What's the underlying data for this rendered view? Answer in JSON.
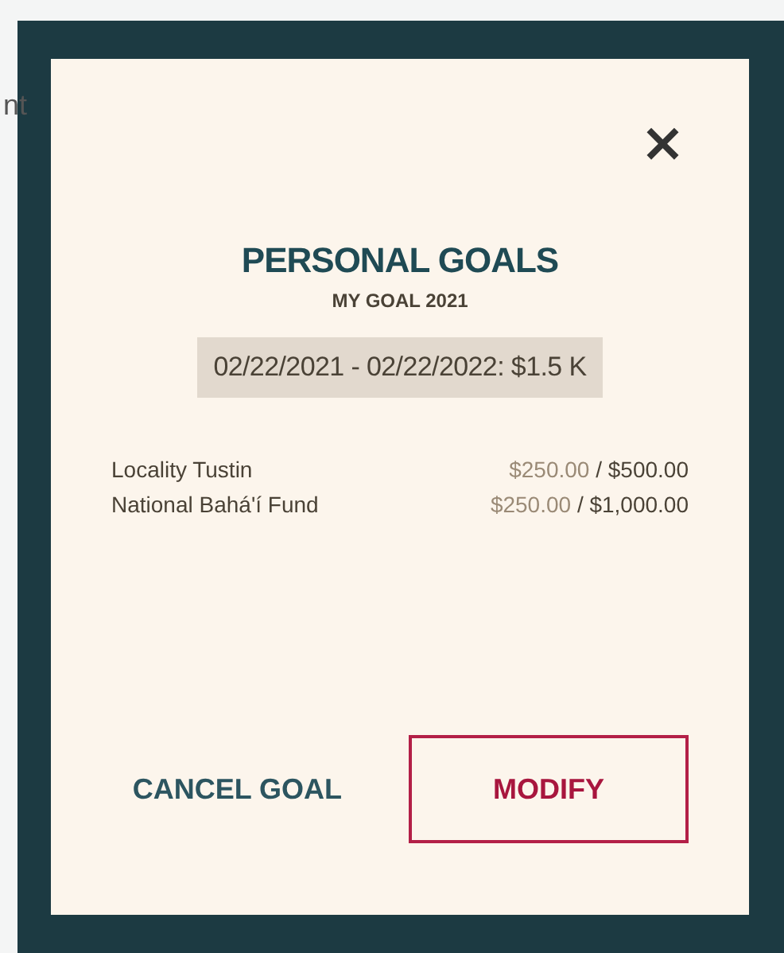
{
  "background_text": "nt",
  "dialog": {
    "close": "×",
    "title": "PERSONAL GOALS",
    "subtitle": "MY GOAL 2021",
    "period": "02/22/2021 - 02/22/2022: $1.5 K",
    "funds": [
      {
        "name": "Locality Tustin",
        "paid": "$250.00",
        "goal": "/ $500.00"
      },
      {
        "name": "National Bahá'í Fund",
        "paid": "$250.00",
        "goal": "/ $1,000.00"
      }
    ],
    "buttons": [
      {
        "label": "CANCEL GOAL",
        "kind": "text"
      },
      {
        "label": "MODIFY",
        "kind": "outlined"
      }
    ]
  }
}
